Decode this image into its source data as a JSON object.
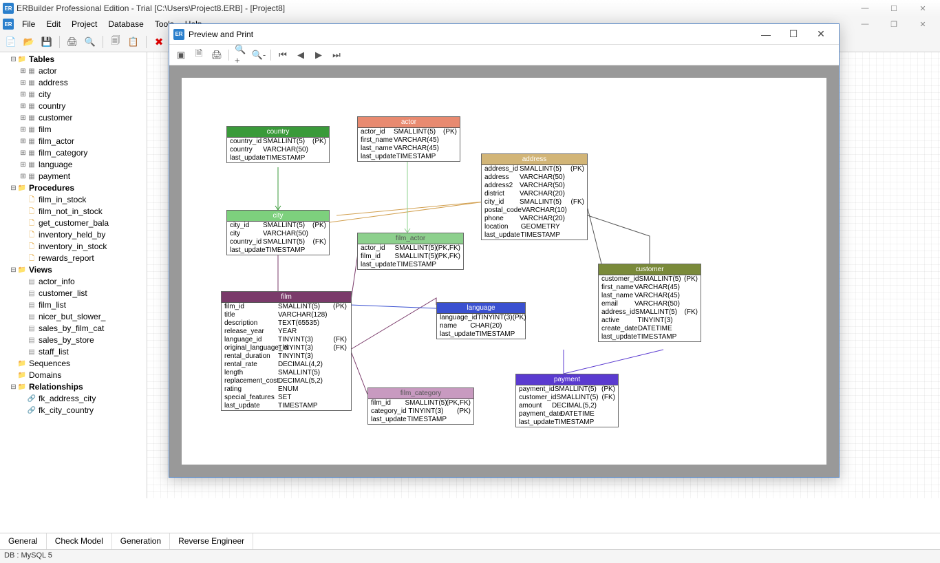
{
  "app": {
    "title": "ERBuilder Professional Edition  - Trial [C:\\Users\\Project8.ERB] - [Project8]"
  },
  "menu": {
    "file": "File",
    "edit": "Edit",
    "project": "Project",
    "database": "Database",
    "tools": "Tools",
    "help": "Help"
  },
  "tree": {
    "tables": "Tables",
    "table_items": [
      "actor",
      "address",
      "city",
      "country",
      "customer",
      "film",
      "film_actor",
      "film_category",
      "language",
      "payment"
    ],
    "procedures": "Procedures",
    "proc_items": [
      "film_in_stock",
      "film_not_in_stock",
      "get_customer_bala",
      "inventory_held_by",
      "inventory_in_stock",
      "rewards_report"
    ],
    "views": "Views",
    "view_items": [
      "actor_info",
      "customer_list",
      "film_list",
      "nicer_but_slower_",
      "sales_by_film_cat",
      "sales_by_store",
      "staff_list"
    ],
    "sequences": "Sequences",
    "domains": "Domains",
    "relationships": "Relationships",
    "rel_items": [
      "fk_address_city",
      "fk_city_country"
    ]
  },
  "tabs": {
    "general": "General",
    "check": "Check Model",
    "gen": "Generation",
    "rev": "Reverse Engineer"
  },
  "status": {
    "db": "DB : MySQL 5"
  },
  "dialog": {
    "title": "Preview and Print"
  },
  "er": {
    "country": {
      "name": "country",
      "cols": [
        [
          "country_id",
          "SMALLINT(5)",
          "(PK)"
        ],
        [
          "country",
          "VARCHAR(50)",
          ""
        ],
        [
          "last_update",
          "TIMESTAMP",
          ""
        ]
      ]
    },
    "city": {
      "name": "city",
      "cols": [
        [
          "city_id",
          "SMALLINT(5)",
          "(PK)"
        ],
        [
          "city",
          "VARCHAR(50)",
          ""
        ],
        [
          "country_id",
          "SMALLINT(5)",
          "(FK)"
        ],
        [
          "last_update",
          "TIMESTAMP",
          ""
        ]
      ]
    },
    "actor": {
      "name": "actor",
      "cols": [
        [
          "actor_id",
          "SMALLINT(5)",
          "(PK)"
        ],
        [
          "first_name",
          "VARCHAR(45)",
          ""
        ],
        [
          "last_name",
          "VARCHAR(45)",
          ""
        ],
        [
          "last_update",
          "TIMESTAMP",
          ""
        ]
      ]
    },
    "film_actor": {
      "name": "film_actor",
      "cols": [
        [
          "actor_id",
          "SMALLINT(5)",
          "(PK,FK)"
        ],
        [
          "film_id",
          "SMALLINT(5)",
          "(PK,FK)"
        ],
        [
          "last_update",
          "TIMESTAMP",
          ""
        ]
      ]
    },
    "address": {
      "name": "address",
      "cols": [
        [
          "address_id",
          "SMALLINT(5)",
          "(PK)"
        ],
        [
          "address",
          "VARCHAR(50)",
          ""
        ],
        [
          "address2",
          "VARCHAR(50)",
          ""
        ],
        [
          "district",
          "VARCHAR(20)",
          ""
        ],
        [
          "city_id",
          "SMALLINT(5)",
          "(FK)"
        ],
        [
          "postal_code",
          "VARCHAR(10)",
          ""
        ],
        [
          "phone",
          "VARCHAR(20)",
          ""
        ],
        [
          "location",
          "GEOMETRY",
          ""
        ],
        [
          "last_update",
          "TIMESTAMP",
          ""
        ]
      ]
    },
    "film": {
      "name": "film",
      "cols": [
        [
          "film_id",
          "SMALLINT(5)",
          "(PK)"
        ],
        [
          "title",
          "VARCHAR(128)",
          ""
        ],
        [
          "description",
          "TEXT(65535)",
          ""
        ],
        [
          "release_year",
          "YEAR",
          ""
        ],
        [
          "language_id",
          "TINYINT(3)",
          "(FK)"
        ],
        [
          "original_language_id",
          "TINYINT(3)",
          "(FK)"
        ],
        [
          "rental_duration",
          "TINYINT(3)",
          ""
        ],
        [
          "rental_rate",
          "DECIMAL(4,2)",
          ""
        ],
        [
          "length",
          "SMALLINT(5)",
          ""
        ],
        [
          "replacement_cost",
          "DECIMAL(5,2)",
          ""
        ],
        [
          "rating",
          "ENUM",
          ""
        ],
        [
          "special_features",
          "SET",
          ""
        ],
        [
          "last_update",
          "TIMESTAMP",
          ""
        ]
      ]
    },
    "language": {
      "name": "language",
      "cols": [
        [
          "language_id",
          "TINYINT(3)",
          "(PK)"
        ],
        [
          "name",
          "CHAR(20)",
          ""
        ],
        [
          "last_update",
          "TIMESTAMP",
          ""
        ]
      ]
    },
    "customer": {
      "name": "customer",
      "cols": [
        [
          "customer_id",
          "SMALLINT(5)",
          "(PK)"
        ],
        [
          "first_name",
          "VARCHAR(45)",
          ""
        ],
        [
          "last_name",
          "VARCHAR(45)",
          ""
        ],
        [
          "email",
          "VARCHAR(50)",
          ""
        ],
        [
          "address_id",
          "SMALLINT(5)",
          "(FK)"
        ],
        [
          "active",
          "TINYINT(3)",
          ""
        ],
        [
          "create_date",
          "DATETIME",
          ""
        ],
        [
          "last_update",
          "TIMESTAMP",
          ""
        ]
      ]
    },
    "payment": {
      "name": "payment",
      "cols": [
        [
          "payment_id",
          "SMALLINT(5)",
          "(PK)"
        ],
        [
          "customer_id",
          "SMALLINT(5)",
          "(FK)"
        ],
        [
          "amount",
          "DECIMAL(5,2)",
          ""
        ],
        [
          "payment_date",
          "DATETIME",
          ""
        ],
        [
          "last_update",
          "TIMESTAMP",
          ""
        ]
      ]
    },
    "film_category": {
      "name": "film_category",
      "cols": [
        [
          "film_id",
          "SMALLINT(5)",
          "(PK,FK)"
        ],
        [
          "category_id",
          "TINYINT(3)",
          "(PK)"
        ],
        [
          "last_update",
          "TIMESTAMP",
          ""
        ]
      ]
    }
  }
}
